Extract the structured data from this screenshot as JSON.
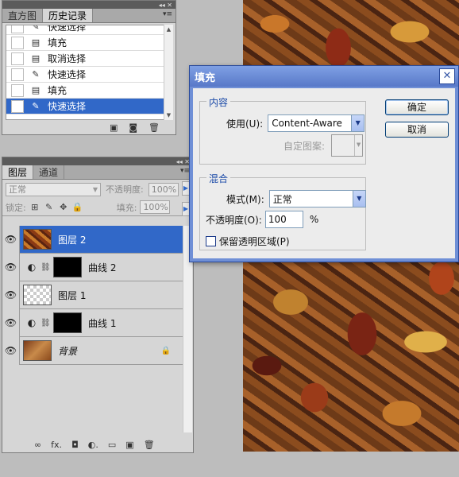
{
  "history_panel": {
    "tabs": [
      "直方图",
      "历史记录"
    ],
    "items": [
      {
        "label": "快速选择",
        "icon": "quick-select-brush-icon"
      },
      {
        "label": "填充",
        "icon": "fill-step-icon"
      },
      {
        "label": "取消选择",
        "icon": "deselect-step-icon"
      },
      {
        "label": "快速选择",
        "icon": "quick-select-brush-icon"
      },
      {
        "label": "填充",
        "icon": "fill-step-icon"
      },
      {
        "label": "快速选择",
        "icon": "quick-select-brush-icon",
        "selected": true
      }
    ]
  },
  "layers_panel": {
    "tabs": [
      "图层",
      "通道"
    ],
    "blend_mode": "正常",
    "opacity_label": "不透明度:",
    "opacity_value": "100%",
    "lock_label": "锁定:",
    "fill_label": "填充:",
    "fill_value": "100%",
    "layers": [
      {
        "name": "图层 2",
        "thumb": "leaves",
        "selected": true
      },
      {
        "name": "曲线 2",
        "thumb": "black",
        "adjustment": true
      },
      {
        "name": "图层 1",
        "thumb": "transparent"
      },
      {
        "name": "曲线 1",
        "thumb": "black-stroke",
        "adjustment": true
      },
      {
        "name": "背景",
        "thumb": "photo",
        "locked": true
      }
    ]
  },
  "fill_dialog": {
    "title": "填充",
    "close": "✕",
    "content_group": "内容",
    "use_label": "使用(U):",
    "use_value": "Content-Aware",
    "custom_pattern_label": "自定图案:",
    "blend_group": "混合",
    "mode_label": "模式(M):",
    "mode_value": "正常",
    "opacity_label": "不透明度(O):",
    "opacity_value": "100",
    "opacity_unit": "%",
    "preserve_label": "保留透明区域(P)",
    "ok_label": "确定",
    "cancel_label": "取消"
  },
  "colors": {
    "selection": "#3168c8",
    "dialog_title": "#6f8fd6",
    "group_label": "#1b4aa8"
  }
}
